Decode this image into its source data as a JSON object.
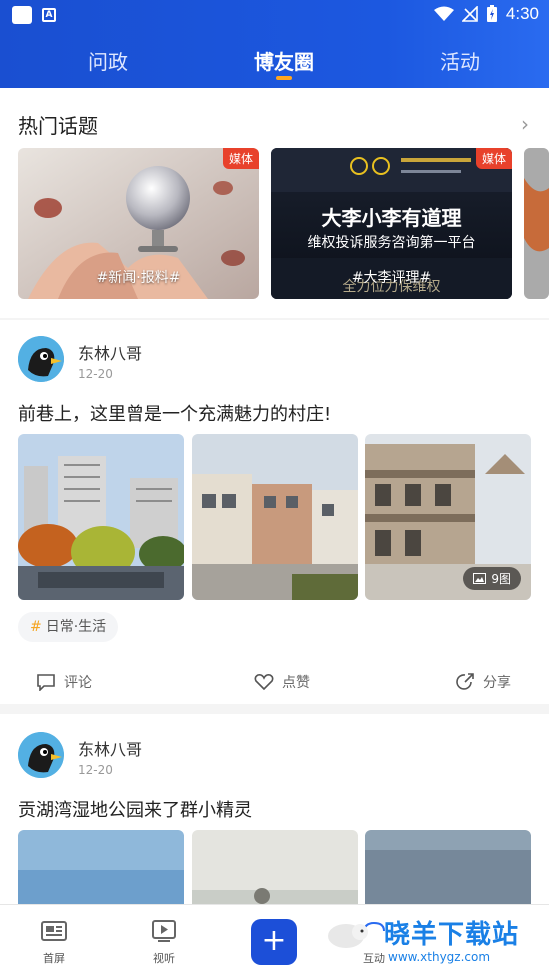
{
  "status_bar": {
    "time": "4:30"
  },
  "tabs": [
    {
      "label": "问政"
    },
    {
      "label": "博友圈"
    },
    {
      "label": "活动"
    }
  ],
  "hot_topics": {
    "title": "热门话题",
    "cards": [
      {
        "tag": "媒体",
        "caption": "#新闻·报料#"
      },
      {
        "tag": "媒体",
        "caption": "#大李评理#",
        "headline": "大李小李有道理",
        "subline": "维权投诉服务咨询第一平台",
        "footer": "全力位力保维权"
      }
    ]
  },
  "posts": [
    {
      "author": "东林八哥",
      "date": "12-20",
      "text": "前巷上，这里曾是一个充满魅力的村庄!",
      "image_count": "9图",
      "topic_tag": "日常·生活",
      "actions": {
        "comment": "评论",
        "like": "点赞",
        "share": "分享"
      }
    },
    {
      "author": "东林八哥",
      "date": "12-20",
      "text": "贡湖湾湿地公园来了群小精灵"
    }
  ],
  "bottom_nav": [
    {
      "label": "首屏",
      "icon": "newspaper-icon"
    },
    {
      "label": "视听",
      "icon": "video-icon"
    },
    {
      "label": "+",
      "icon": "plus-icon"
    },
    {
      "label": "互动",
      "icon": "interaction-icon"
    }
  ],
  "watermark": {
    "text": "晓羊下载站",
    "url_text": "www.xthygz.com"
  },
  "colors": {
    "header_blue": "#1c4fd8",
    "indicator": "#ffa51f",
    "media_tag": "#e8412b",
    "hash": "#f5a623"
  }
}
